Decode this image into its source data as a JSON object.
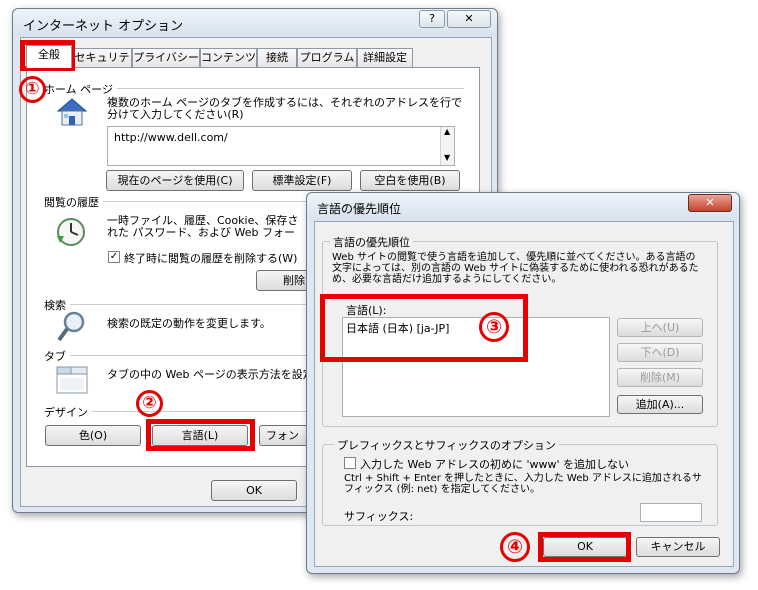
{
  "main_dialog": {
    "title": "インターネット オプション",
    "help_btn": "?",
    "close_btn": "✕",
    "tabs": [
      "全般",
      "セキュリティ",
      "プライバシー",
      "コンテンツ",
      "接続",
      "プログラム",
      "詳細設定"
    ],
    "homepage": {
      "section": "ホーム ページ",
      "desc": "複数のホーム ページのタブを作成するには、それぞれのアドレスを行で分けて入力してください(R)",
      "url": "http://www.dell.com/",
      "btn_current": "現在のページを使用(C)",
      "btn_default": "標準設定(F)",
      "btn_blank": "空白を使用(B)"
    },
    "history": {
      "section": "閲覧の履歴",
      "desc": "一時ファイル、履歴、Cookie、保存された パスワード、および Web フォーム の情報を削除します。",
      "checkbox": "終了時に閲覧の履歴を削除する(W)",
      "btn_delete": "削除"
    },
    "search": {
      "section": "検索",
      "desc": "検索の既定の動作を変更します。"
    },
    "tabs_section": {
      "section": "タブ",
      "desc": "タブの中の Web ページの表示方法を設定"
    },
    "design": {
      "section": "デザイン",
      "btn_color": "色(O)",
      "btn_language": "言語(L)",
      "btn_font": "フォン"
    },
    "ok": "OK"
  },
  "lang_dialog": {
    "title": "言語の優先順位",
    "close_btn": "✕",
    "group_title": "言語の優先順位",
    "desc": "Web サイトの閲覧で使う言語を追加して、優先順に並べてください。ある言語の文字によっては、別の言語の Web サイトに偽装するために使われる恐れがあるため、必要な言語だけ追加するようにしてください。",
    "list_label": "言語(L):",
    "languages": [
      "日本語 (日本) [ja-JP]"
    ],
    "btn_up": "上へ(U)",
    "btn_down": "下へ(D)",
    "btn_remove": "削除(M)",
    "btn_add": "追加(A)...",
    "prefix_group": "プレフィックスとサフィックスのオプション",
    "prefix_checkbox": "入力した Web アドレスの初めに 'www' を追加しない",
    "prefix_desc": "Ctrl + Shift + Enter を押したときに、入力した Web アドレスに追加されるサフィックス (例: net) を指定してください。",
    "suffix_label": "サフィックス:",
    "suffix_value": "",
    "ok": "OK",
    "cancel": "キャンセル"
  },
  "markers": [
    "①",
    "②",
    "③",
    "④"
  ]
}
